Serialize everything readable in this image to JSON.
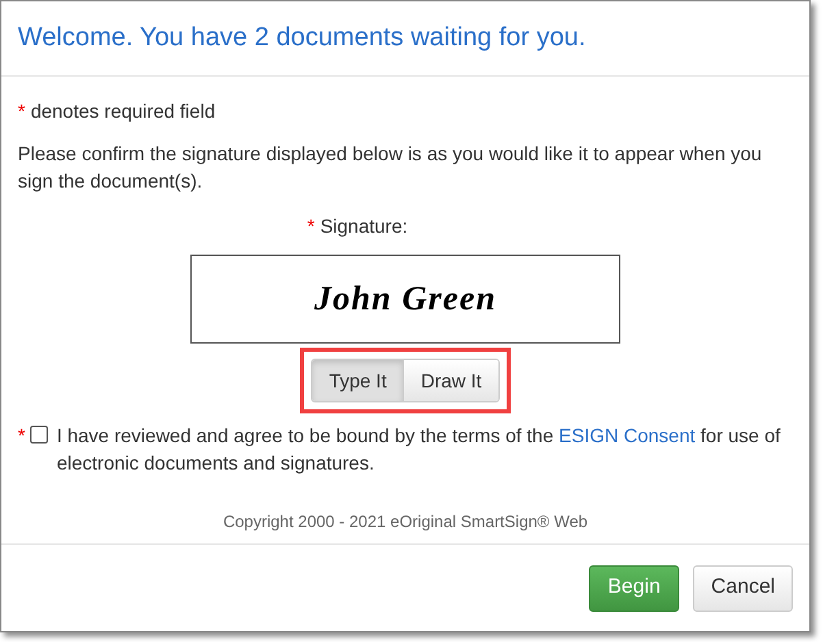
{
  "dialog": {
    "title": "Welcome. You have 2 documents waiting for you."
  },
  "required_note": {
    "marker": "*",
    "text": "denotes required field"
  },
  "instructions": "Please confirm the signature displayed below is as you would like it to appear when you sign the document(s).",
  "signature": {
    "marker": "*",
    "label": "Signature:",
    "value": "John Green"
  },
  "mode_toggle": [
    {
      "label": "Type It",
      "selected": true
    },
    {
      "label": "Draw It",
      "selected": false
    }
  ],
  "agreement": {
    "marker": "*",
    "checked": false,
    "text_before": "I have reviewed and agree to be bound by the terms of the",
    "link": "ESIGN Consent",
    "text_after": "for use of electronic documents and signatures."
  },
  "copyright": "Copyright 2000 - 2021 eOriginal SmartSign® Web",
  "buttons": [
    {
      "label": "Begin",
      "kind": "primary"
    },
    {
      "label": "Cancel",
      "kind": "default"
    }
  ]
}
